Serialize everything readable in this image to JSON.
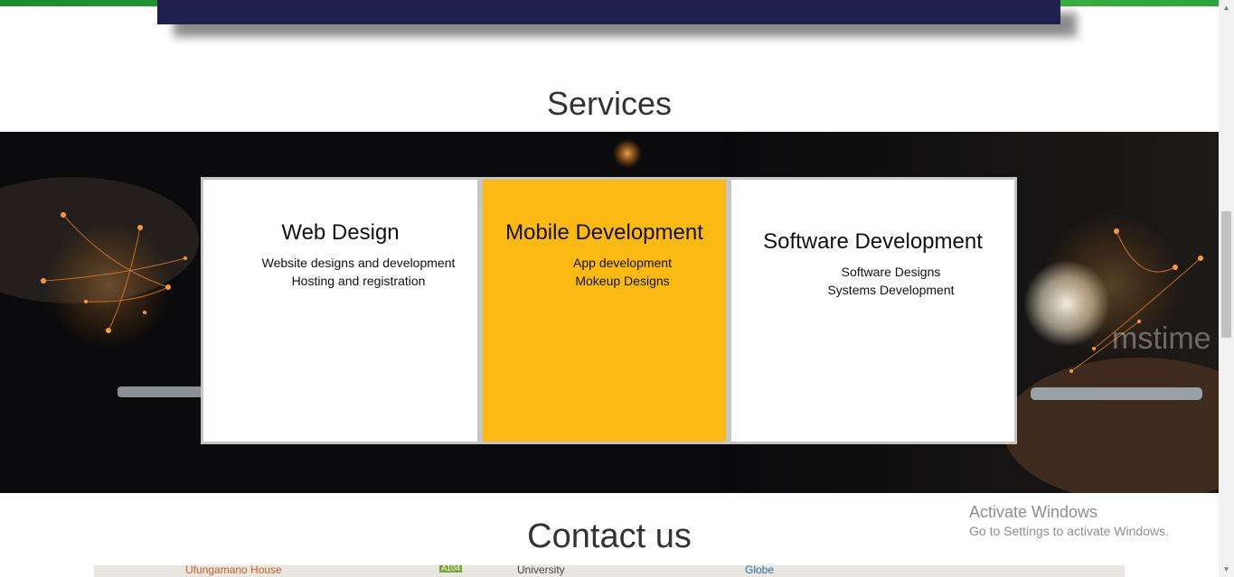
{
  "services": {
    "title": "Services",
    "cards": [
      {
        "title": "Web Design",
        "lines": [
          "Website designs and development",
          "Hosting and registration"
        ],
        "color": "#ffffff"
      },
      {
        "title": "Mobile Development",
        "lines": [
          "App development",
          "Mokeup Designs"
        ],
        "color": "#fdb913"
      },
      {
        "title": "Software Development",
        "lines": [
          "Software Designs",
          "Systems Development"
        ],
        "color": "#ffffff"
      }
    ]
  },
  "hero": {
    "watermark_text": "mstime"
  },
  "contact": {
    "title": "Contact us"
  },
  "map": {
    "labels": [
      "Ufungamano House",
      "A104",
      "University",
      "Globe"
    ]
  },
  "windows_watermark": {
    "line1": "Activate Windows",
    "line2": "Go to Settings to activate Windows."
  },
  "colors": {
    "navbar": "#20204f",
    "accent": "#fdb913",
    "topstrip": "#2ca43a"
  }
}
